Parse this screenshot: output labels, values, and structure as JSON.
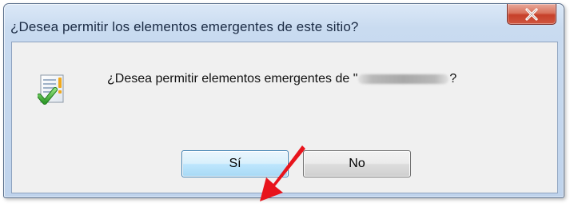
{
  "dialog": {
    "title": "¿Desea permitir los elementos emergentes de este sitio?",
    "close_icon": "close-icon",
    "message_prefix": "¿Desea permitir elementos emergentes de \"",
    "message_suffix": "?",
    "message_icon": "warning-document-icon",
    "buttons": {
      "yes_label": "Sí",
      "no_label": "No"
    }
  },
  "annotation": {
    "arrow_color": "#e8141c"
  },
  "colors": {
    "close_button": "#c6402a",
    "title_bar": "#c9dbf0",
    "client_bg": "#f0f0f0",
    "default_button_border": "#3c7fb1"
  }
}
